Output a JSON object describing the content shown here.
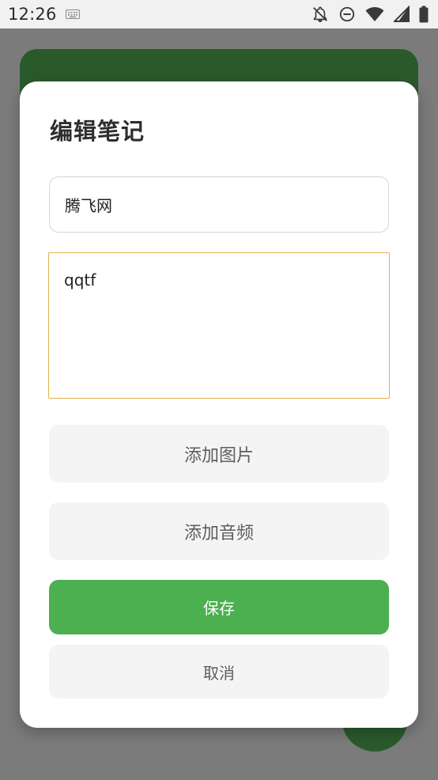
{
  "status_bar": {
    "time": "12:26",
    "icons": [
      "keyboard-icon",
      "notifications-off-icon",
      "do-not-disturb-icon",
      "wifi-icon",
      "cellular-signal-icon",
      "battery-icon"
    ]
  },
  "dialog": {
    "title": "编辑笔记",
    "title_field_value": "腾飞网",
    "content_field_value": "qqtf",
    "add_image_label": "添加图片",
    "add_audio_label": "添加音频",
    "save_label": "保存",
    "cancel_label": "取消"
  },
  "colors": {
    "accent": "#4caf50",
    "background_app_bar": "#2a5a2c",
    "focused_border": "#e2b24a",
    "scrim": "#7b7b7b"
  }
}
